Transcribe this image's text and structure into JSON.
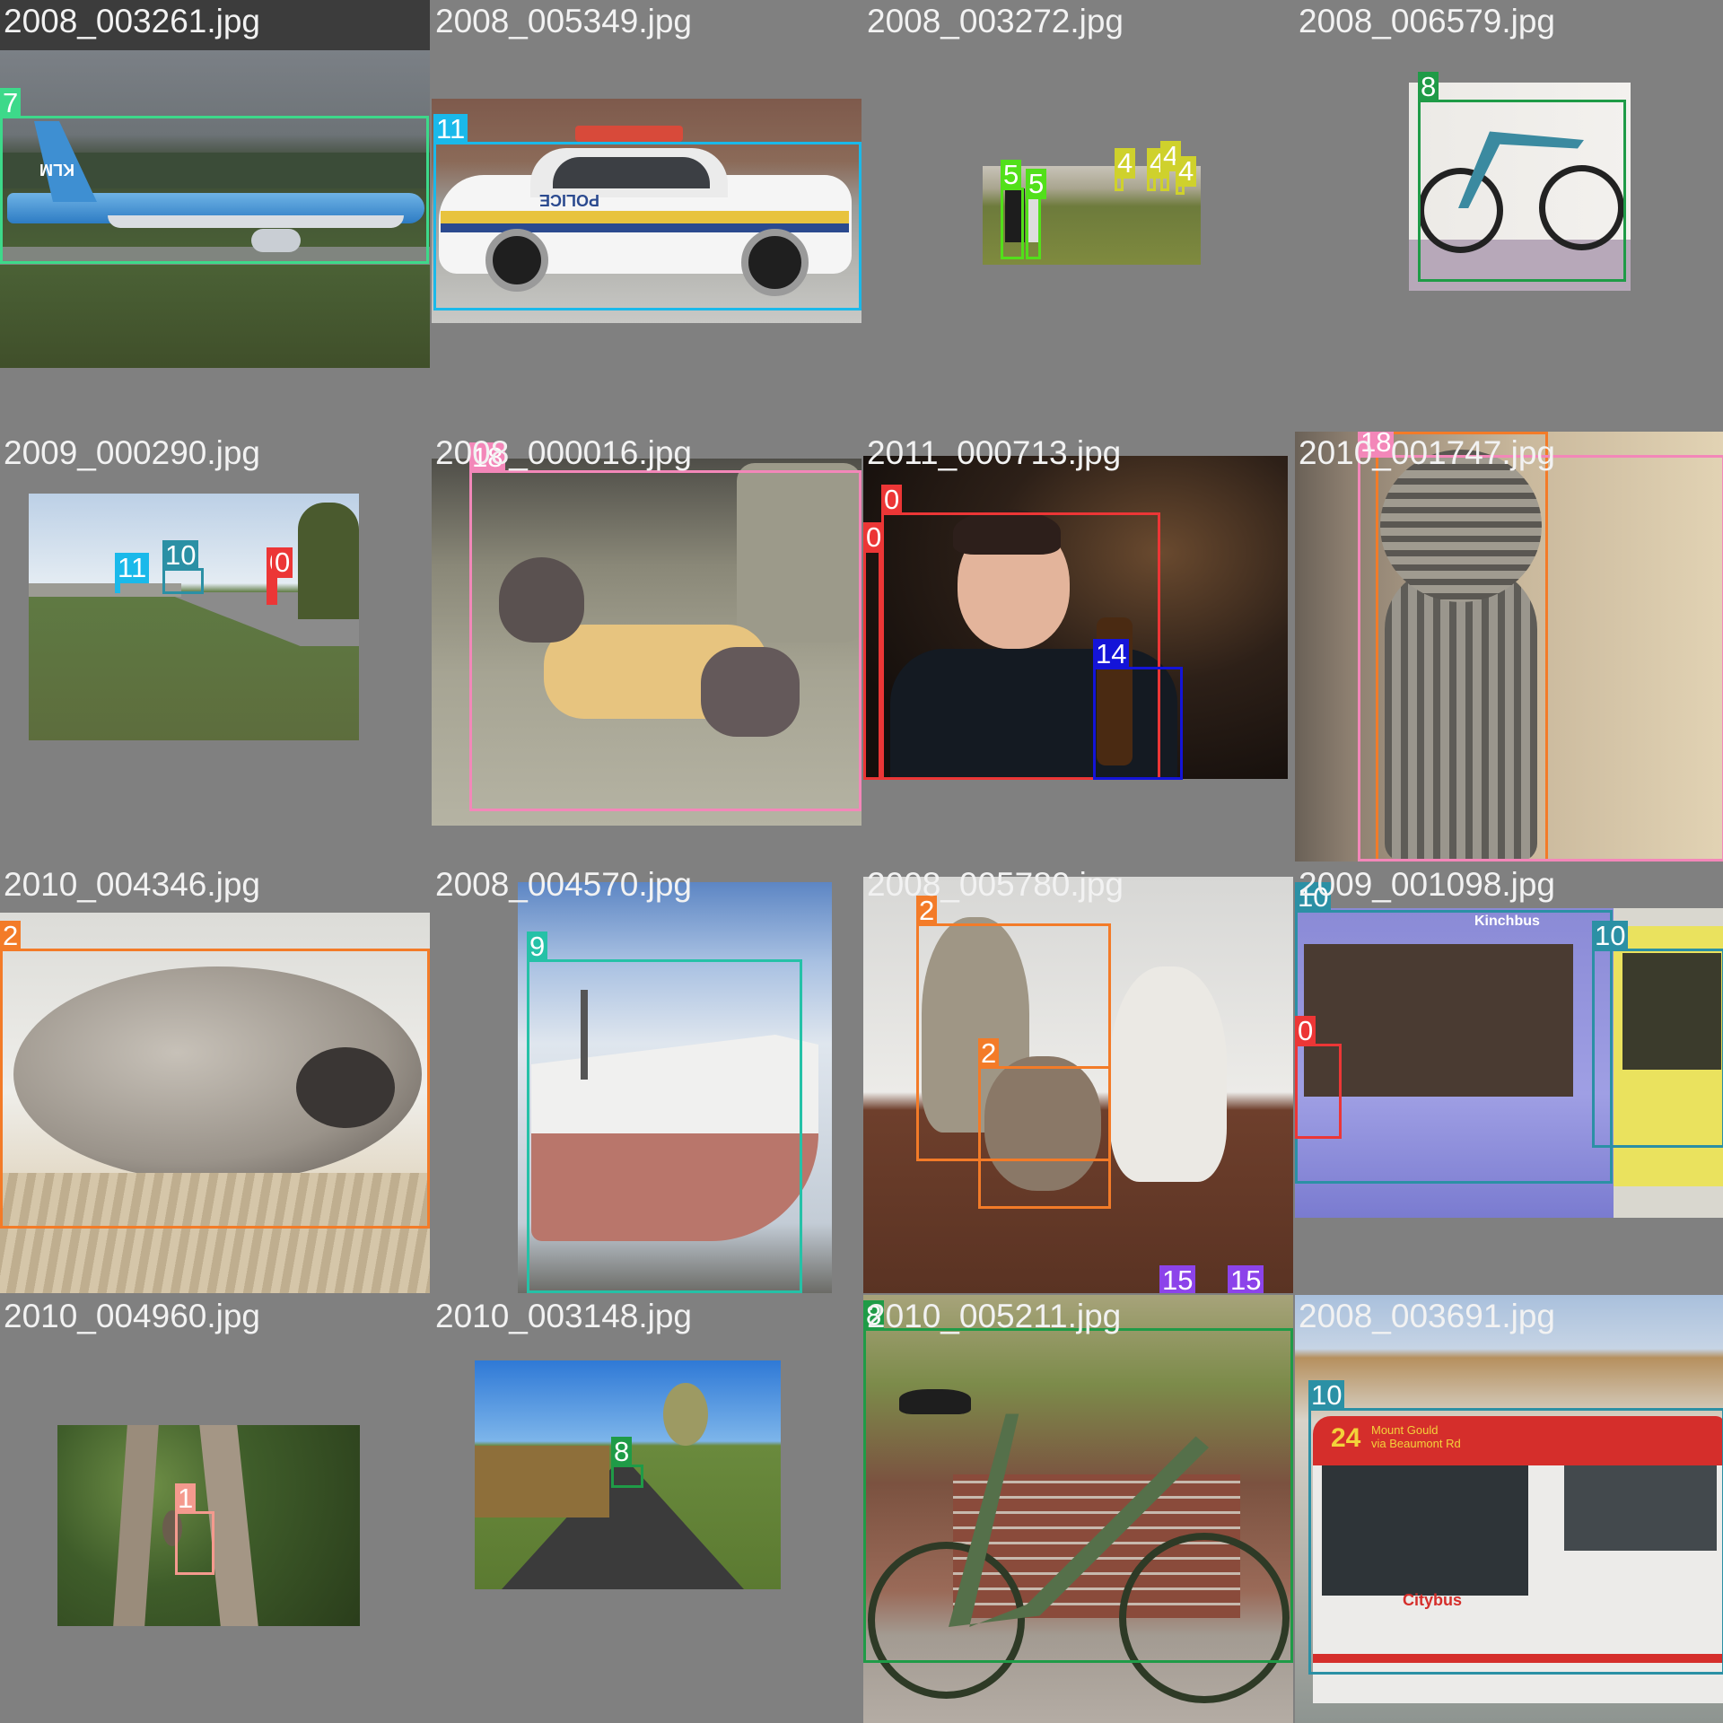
{
  "mosaic": {
    "tiles": [
      {
        "filename": "2008_003261.jpg",
        "scene": "KLM airliner on runway",
        "labels": [
          {
            "cls": "7",
            "color": "#3dd98a"
          }
        ]
      },
      {
        "filename": "2008_005349.jpg",
        "scene": "police car on street",
        "labels": [
          {
            "cls": "11",
            "color": "#1ab9ea"
          }
        ]
      },
      {
        "filename": "2008_003272.jpg",
        "scene": "people on grass field with chairs",
        "labels": [
          {
            "cls": "5",
            "color": "#52e01a"
          },
          {
            "cls": "5",
            "color": "#52e01a"
          },
          {
            "cls": "4",
            "color": "#cfd12c"
          },
          {
            "cls": "4",
            "color": "#cfd12c"
          },
          {
            "cls": "4",
            "color": "#cfd12c"
          },
          {
            "cls": "4",
            "color": "#cfd12c"
          }
        ]
      },
      {
        "filename": "2008_006579.jpg",
        "scene": "mountain bike indoors",
        "labels": [
          {
            "cls": "8",
            "color": "#1f9b47"
          }
        ]
      },
      {
        "filename": "2009_000290.jpg",
        "scene": "road with bus, car and person",
        "labels": [
          {
            "cls": "11",
            "color": "#1ab9ea"
          },
          {
            "cls": "10",
            "color": "#2b90a5"
          },
          {
            "cls": "0",
            "color": "#ec3636"
          },
          {
            "cls": "0",
            "color": "#ec3636"
          }
        ]
      },
      {
        "filename": "2008_000016.jpg",
        "scene": "dog wearing shirt on sofa",
        "labels": [
          {
            "cls": "18",
            "color": "#f387b9"
          }
        ]
      },
      {
        "filename": "2011_000713.jpg",
        "scene": "man drinking from bottle",
        "labels": [
          {
            "cls": "0",
            "color": "#ec3636"
          },
          {
            "cls": "0",
            "color": "#ec3636"
          },
          {
            "cls": "14",
            "color": "#1414d8"
          }
        ]
      },
      {
        "filename": "2010_001747.jpg",
        "scene": "tabby kitten on sofa",
        "labels": [
          {
            "cls": "2",
            "color": "#f37b28"
          },
          {
            "cls": "18",
            "color": "#f387b9"
          }
        ]
      },
      {
        "filename": "2010_004346.jpg",
        "scene": "siamese cat sleeping in basket",
        "labels": [
          {
            "cls": "2",
            "color": "#f37b28"
          }
        ]
      },
      {
        "filename": "2008_004570.jpg",
        "scene": "ship in dry dock",
        "labels": [
          {
            "cls": "9",
            "color": "#25c1a7"
          }
        ]
      },
      {
        "filename": "2008_005780.jpg",
        "scene": "three cats on table",
        "labels": [
          {
            "cls": "2",
            "color": "#f37b28"
          },
          {
            "cls": "2",
            "color": "#f37b28"
          },
          {
            "cls": "15",
            "color": "#8c43ea"
          },
          {
            "cls": "15",
            "color": "#8c43ea"
          }
        ]
      },
      {
        "filename": "2009_001098.jpg",
        "scene": "two buses",
        "labels": [
          {
            "cls": "10",
            "color": "#2b90a5"
          },
          {
            "cls": "10",
            "color": "#2b90a5"
          },
          {
            "cls": "0",
            "color": "#ec3636"
          }
        ]
      },
      {
        "filename": "2010_004960.jpg",
        "scene": "bird in tree",
        "labels": [
          {
            "cls": "1",
            "color": "#f49a8e"
          }
        ]
      },
      {
        "filename": "2010_003148.jpg",
        "scene": "country road with bicycle",
        "labels": [
          {
            "cls": "8",
            "color": "#1f9b47"
          }
        ]
      },
      {
        "filename": "2010_005211.jpg",
        "scene": "green bicycle leaning on wall",
        "labels": [
          {
            "cls": "8",
            "color": "#1f9b47"
          }
        ]
      },
      {
        "filename": "2008_003691.jpg",
        "scene": "red and white city bus",
        "labels": [
          {
            "cls": "10",
            "color": "#2b90a5"
          }
        ]
      }
    ]
  },
  "bus_text": {
    "route": "24",
    "destination": "Mount Gould\nvia Beaumont Rd",
    "brand": "Citybus",
    "brand_top": "Kinchbus"
  },
  "klm_logo": "KLM",
  "police_text": "POLICE"
}
